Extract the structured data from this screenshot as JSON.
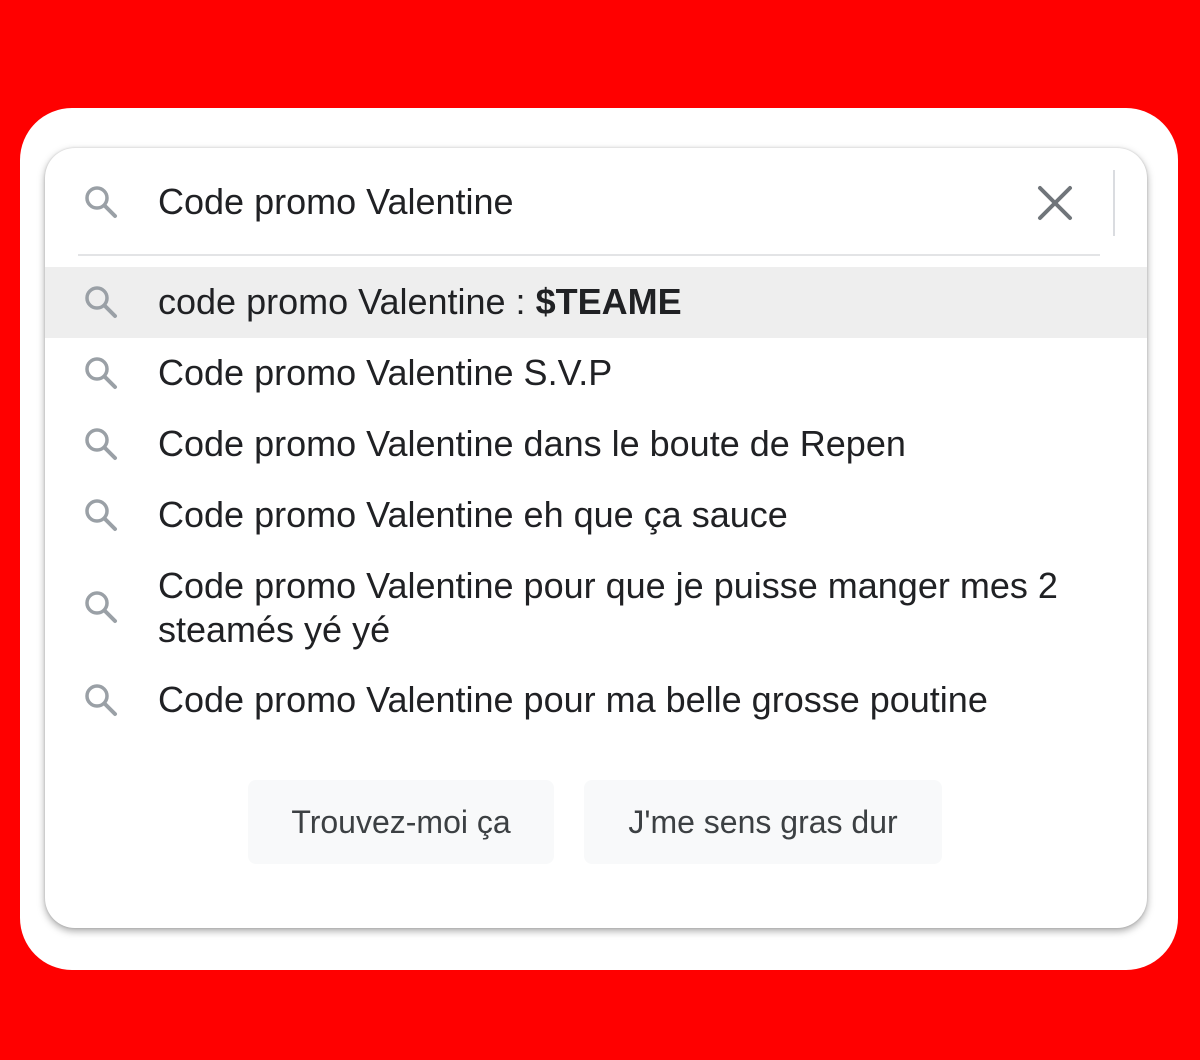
{
  "search": {
    "query": "Code promo Valentine",
    "icon": "search-icon",
    "clear_icon": "close-icon"
  },
  "suggestions": [
    {
      "prefix": "code promo Valentine : ",
      "bold": "$TEAME",
      "highlighted": true
    },
    {
      "prefix": "Code promo Valentine S.V.P",
      "bold": ""
    },
    {
      "prefix": "Code promo Valentine dans le boute de Repen",
      "bold": ""
    },
    {
      "prefix": "Code promo Valentine eh que ça sauce",
      "bold": ""
    },
    {
      "prefix": "Code promo Valentine pour que je puisse manger mes 2 steamés yé yé",
      "bold": ""
    },
    {
      "prefix": "Code promo Valentine pour ma belle grosse poutine",
      "bold": ""
    }
  ],
  "buttons": {
    "search_label": "Trouvez-moi ça",
    "lucky_label": "J'me sens gras dur"
  },
  "colors": {
    "background": "#ff0000",
    "highlight": "#eeeeee",
    "text": "#202124",
    "icon": "#9aa0a6",
    "button_bg": "#f8f9fa"
  }
}
